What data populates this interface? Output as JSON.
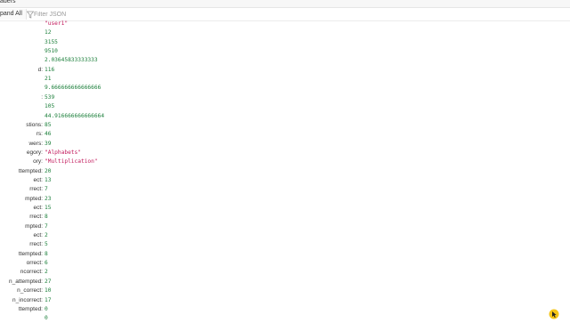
{
  "tab": {
    "title": "aders"
  },
  "toolbar": {
    "expand_all_label": "pand All",
    "filter_placeholder": "Filter JSON"
  },
  "rows": [
    {
      "key": "",
      "value": "\"user1\"",
      "kind": "str"
    },
    {
      "key": "",
      "value": "12",
      "kind": "num"
    },
    {
      "key": "",
      "value": "3155",
      "kind": "num"
    },
    {
      "key": "",
      "value": "9510",
      "kind": "num"
    },
    {
      "key": "",
      "value": "2.03645833333333",
      "kind": "num"
    },
    {
      "key": "d:",
      "value": "116",
      "kind": "num"
    },
    {
      "key": "",
      "value": "21",
      "kind": "num"
    },
    {
      "key": "",
      "value": "9.666666666666666",
      "kind": "num"
    },
    {
      "key": ":",
      "value": "539",
      "kind": "num"
    },
    {
      "key": "",
      "value": "105",
      "kind": "num"
    },
    {
      "key": "",
      "value": "44.916666666666664",
      "kind": "num"
    },
    {
      "key": "stions:",
      "value": "85",
      "kind": "num"
    },
    {
      "key": "rs:",
      "value": "46",
      "kind": "num"
    },
    {
      "key": "wers:",
      "value": "39",
      "kind": "num"
    },
    {
      "key": "egory:",
      "value": "\"Alphabets\"",
      "kind": "str"
    },
    {
      "key": "ory:",
      "value": "\"Multiplication\"",
      "kind": "str"
    },
    {
      "key": "ttempted:",
      "value": "20",
      "kind": "num"
    },
    {
      "key": "ect:",
      "value": "13",
      "kind": "num"
    },
    {
      "key": "rrect:",
      "value": "7",
      "kind": "num"
    },
    {
      "key": "mpted:",
      "value": "23",
      "kind": "num"
    },
    {
      "key": "ect:",
      "value": "15",
      "kind": "num"
    },
    {
      "key": "rrect:",
      "value": "8",
      "kind": "num"
    },
    {
      "key": "mpted:",
      "value": "7",
      "kind": "num"
    },
    {
      "key": "ect:",
      "value": "2",
      "kind": "num"
    },
    {
      "key": "rrect:",
      "value": "5",
      "kind": "num"
    },
    {
      "key": "ttempted:",
      "value": "8",
      "kind": "num"
    },
    {
      "key": "orrect:",
      "value": "6",
      "kind": "num"
    },
    {
      "key": "ncorrect:",
      "value": "2",
      "kind": "num"
    },
    {
      "key": "n_attempted:",
      "value": "27",
      "kind": "num"
    },
    {
      "key": "n_correct:",
      "value": "10",
      "kind": "num"
    },
    {
      "key": "n_incorrect:",
      "value": "17",
      "kind": "num"
    },
    {
      "key": "ttempted:",
      "value": "0",
      "kind": "num"
    },
    {
      "key": "",
      "value": "0",
      "kind": "num"
    }
  ],
  "colors": {
    "number": "#1b7f3a",
    "string": "#c2185b"
  },
  "icons": {
    "filter": "filter-icon",
    "corner": "cursor-icon"
  }
}
